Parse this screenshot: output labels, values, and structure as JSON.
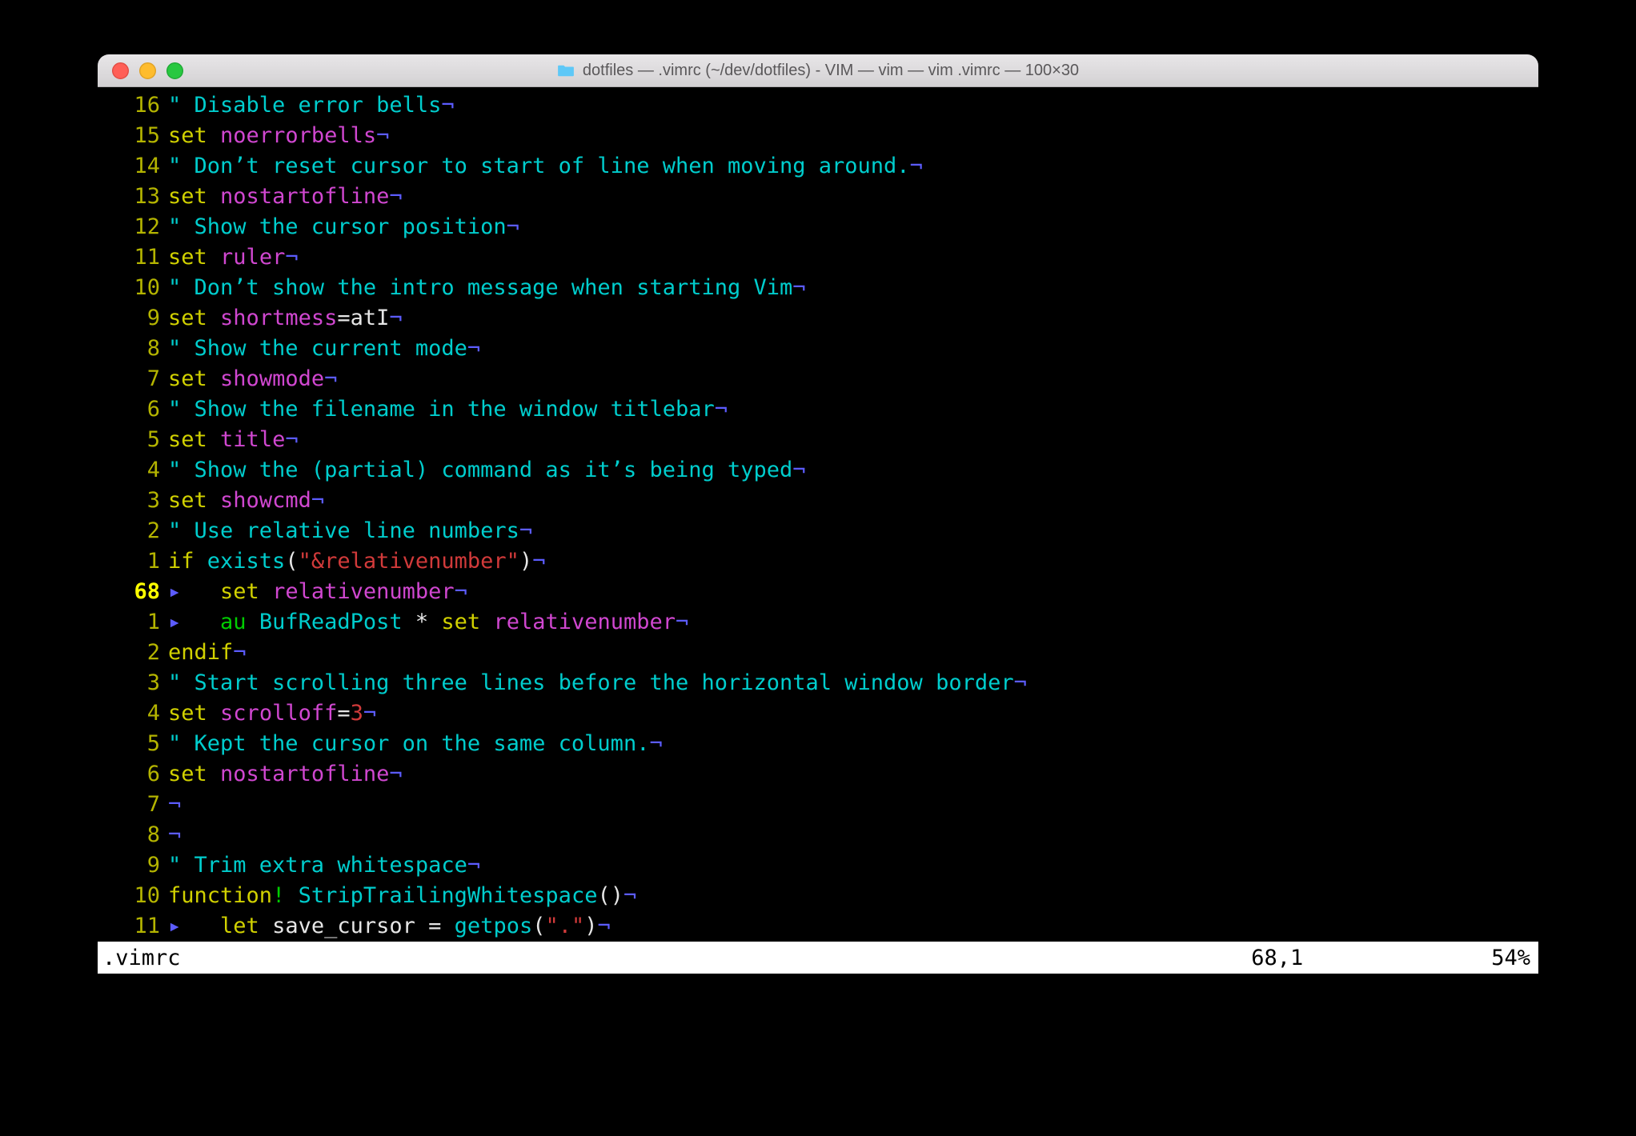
{
  "window": {
    "title": "dotfiles — .vimrc (~/dev/dotfiles) - VIM — vim — vim .vimrc — 100×30"
  },
  "status": {
    "file": ".vimrc",
    "pos": "68,1",
    "pct": "54%"
  },
  "eol": "¬",
  "tab": "▸   ",
  "lines": [
    {
      "num": "16",
      "segs": [
        {
          "c": "tok-comment",
          "t": "\" Disable error bells"
        }
      ]
    },
    {
      "num": "15",
      "segs": [
        {
          "c": "tok-cmd",
          "t": "set"
        },
        {
          "c": "tok-normal",
          "t": " "
        },
        {
          "c": "tok-opt",
          "t": "noerrorbells"
        }
      ]
    },
    {
      "num": "14",
      "segs": [
        {
          "c": "tok-comment",
          "t": "\" Don’t reset cursor to start of line when moving around."
        }
      ]
    },
    {
      "num": "13",
      "segs": [
        {
          "c": "tok-cmd",
          "t": "set"
        },
        {
          "c": "tok-normal",
          "t": " "
        },
        {
          "c": "tok-opt",
          "t": "nostartofline"
        }
      ]
    },
    {
      "num": "12",
      "segs": [
        {
          "c": "tok-comment",
          "t": "\" Show the cursor position"
        }
      ]
    },
    {
      "num": "11",
      "segs": [
        {
          "c": "tok-cmd",
          "t": "set"
        },
        {
          "c": "tok-normal",
          "t": " "
        },
        {
          "c": "tok-opt",
          "t": "ruler"
        }
      ]
    },
    {
      "num": "10",
      "segs": [
        {
          "c": "tok-comment",
          "t": "\" Don’t show the intro message when starting Vim"
        }
      ]
    },
    {
      "num": "9",
      "segs": [
        {
          "c": "tok-cmd",
          "t": "set"
        },
        {
          "c": "tok-normal",
          "t": " "
        },
        {
          "c": "tok-opt",
          "t": "shortmess"
        },
        {
          "c": "tok-normal",
          "t": "="
        },
        {
          "c": "tok-normal",
          "t": "atI"
        }
      ]
    },
    {
      "num": "8",
      "segs": [
        {
          "c": "tok-comment",
          "t": "\" Show the current mode"
        }
      ]
    },
    {
      "num": "7",
      "segs": [
        {
          "c": "tok-cmd",
          "t": "set"
        },
        {
          "c": "tok-normal",
          "t": " "
        },
        {
          "c": "tok-opt",
          "t": "showmode"
        }
      ]
    },
    {
      "num": "6",
      "segs": [
        {
          "c": "tok-comment",
          "t": "\" Show the filename in the window titlebar"
        }
      ]
    },
    {
      "num": "5",
      "segs": [
        {
          "c": "tok-cmd",
          "t": "set"
        },
        {
          "c": "tok-normal",
          "t": " "
        },
        {
          "c": "tok-opt",
          "t": "title"
        }
      ]
    },
    {
      "num": "4",
      "segs": [
        {
          "c": "tok-comment",
          "t": "\" Show the (partial) command as it’s being typed"
        }
      ]
    },
    {
      "num": "3",
      "segs": [
        {
          "c": "tok-cmd",
          "t": "set"
        },
        {
          "c": "tok-normal",
          "t": " "
        },
        {
          "c": "tok-opt",
          "t": "showcmd"
        }
      ]
    },
    {
      "num": "2",
      "segs": [
        {
          "c": "tok-comment",
          "t": "\" Use relative line numbers"
        }
      ]
    },
    {
      "num": "1",
      "segs": [
        {
          "c": "tok-cmd",
          "t": "if"
        },
        {
          "c": "tok-normal",
          "t": " "
        },
        {
          "c": "tok-func",
          "t": "exists"
        },
        {
          "c": "tok-normal",
          "t": "("
        },
        {
          "c": "tok-str",
          "t": "\"&relativenumber\""
        },
        {
          "c": "tok-normal",
          "t": ")"
        }
      ]
    },
    {
      "num": "68",
      "current": true,
      "tab": true,
      "segs": [
        {
          "c": "tok-cmd",
          "t": "set"
        },
        {
          "c": "tok-normal",
          "t": " "
        },
        {
          "c": "tok-opt",
          "t": "relativenumber"
        }
      ]
    },
    {
      "num": "1",
      "tab": true,
      "segs": [
        {
          "c": "tok-au",
          "t": "au"
        },
        {
          "c": "tok-normal",
          "t": " "
        },
        {
          "c": "tok-star",
          "t": "BufReadPost"
        },
        {
          "c": "tok-normal",
          "t": " "
        },
        {
          "c": "tok-normal",
          "t": "*"
        },
        {
          "c": "tok-normal",
          "t": " "
        },
        {
          "c": "tok-cmd",
          "t": "set"
        },
        {
          "c": "tok-normal",
          "t": " "
        },
        {
          "c": "tok-opt",
          "t": "relativenumber"
        }
      ]
    },
    {
      "num": "2",
      "segs": [
        {
          "c": "tok-cmd",
          "t": "endif"
        }
      ]
    },
    {
      "num": "3",
      "segs": [
        {
          "c": "tok-comment",
          "t": "\" Start scrolling three lines before the horizontal window border"
        }
      ]
    },
    {
      "num": "4",
      "segs": [
        {
          "c": "tok-cmd",
          "t": "set"
        },
        {
          "c": "tok-normal",
          "t": " "
        },
        {
          "c": "tok-opt",
          "t": "scrolloff"
        },
        {
          "c": "tok-normal",
          "t": "="
        },
        {
          "c": "tok-num",
          "t": "3"
        }
      ]
    },
    {
      "num": "5",
      "segs": [
        {
          "c": "tok-comment",
          "t": "\" Kept the cursor on the same column."
        }
      ]
    },
    {
      "num": "6",
      "segs": [
        {
          "c": "tok-cmd",
          "t": "set"
        },
        {
          "c": "tok-normal",
          "t": " "
        },
        {
          "c": "tok-opt",
          "t": "nostartofline"
        }
      ]
    },
    {
      "num": "7",
      "segs": []
    },
    {
      "num": "8",
      "segs": []
    },
    {
      "num": "9",
      "segs": [
        {
          "c": "tok-comment",
          "t": "\" Trim extra whitespace"
        }
      ]
    },
    {
      "num": "10",
      "segs": [
        {
          "c": "tok-cmd",
          "t": "function"
        },
        {
          "c": "tok-bang",
          "t": "!"
        },
        {
          "c": "tok-normal",
          "t": " "
        },
        {
          "c": "tok-ident",
          "t": "StripTrailingWhitespace"
        },
        {
          "c": "tok-normal",
          "t": "()"
        }
      ]
    },
    {
      "num": "11",
      "tab": true,
      "segs": [
        {
          "c": "tok-cmd",
          "t": "let"
        },
        {
          "c": "tok-normal",
          "t": " save_cursor "
        },
        {
          "c": "tok-normal",
          "t": "="
        },
        {
          "c": "tok-normal",
          "t": " "
        },
        {
          "c": "tok-func",
          "t": "getpos"
        },
        {
          "c": "tok-normal",
          "t": "("
        },
        {
          "c": "tok-str",
          "t": "\".\""
        },
        {
          "c": "tok-normal",
          "t": ")"
        }
      ]
    }
  ]
}
